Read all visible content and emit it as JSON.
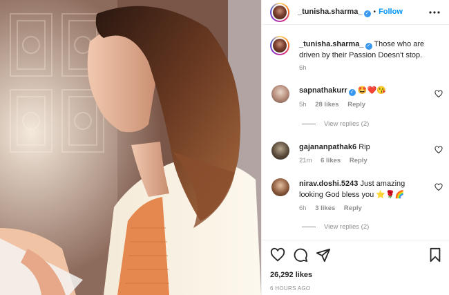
{
  "post": {
    "username": "_tunisha.sharma_",
    "follow_label": "Follow",
    "caption": "Those who are driven by their Passion Doesn't stop.",
    "caption_age": "6h",
    "likes": "26,292 likes",
    "timestamp": "6 HOURS AGO"
  },
  "comments": [
    {
      "username": "sapnathakurr",
      "verified": true,
      "text": "🤩❤️😘",
      "age": "5h",
      "likes": "28 likes",
      "reply": "Reply",
      "view_replies": "View replies (2)"
    },
    {
      "username": "gajananpathak6",
      "text": "Rip",
      "age": "21m",
      "likes": "6 likes",
      "reply": "Reply"
    },
    {
      "username": "nirav.doshi.5243",
      "text_line1": "Just amazing",
      "text_line2": "looking God bless you ⭐🌹🌈",
      "age": "6h",
      "likes": "3 likes",
      "reply": "Reply",
      "view_replies": "View replies (2)"
    }
  ],
  "icons": {
    "header_menu": "more-icon",
    "verified": "verified-icon",
    "like": "heart-icon",
    "comment": "comment-icon",
    "share": "share-icon",
    "save": "bookmark-icon"
  },
  "colors": {
    "accent": "#0095f6",
    "verified": "#3897f0",
    "muted": "#8e8e8e"
  }
}
